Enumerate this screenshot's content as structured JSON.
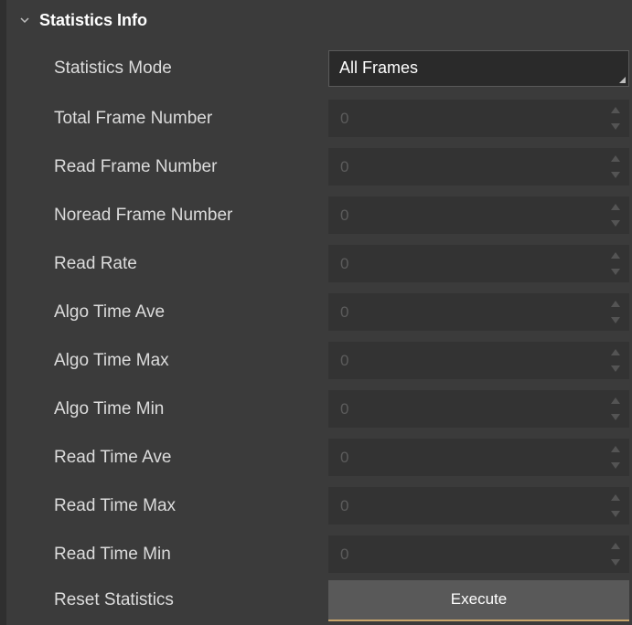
{
  "section": {
    "title": "Statistics Info",
    "toggle_icon": "chevron-down-icon"
  },
  "colors": {
    "panel_bg": "#3b3b3b",
    "field_bg": "#333333",
    "select_bg": "#2a2a2a",
    "button_bg": "#595959",
    "button_accent": "#c9a56b",
    "text": "#dcdcdc",
    "disabled_text": "#5c5c5c"
  },
  "statistics_mode": {
    "label": "Statistics Mode",
    "value": "All Frames"
  },
  "fields": [
    {
      "label": "Total Frame Number",
      "value": "0"
    },
    {
      "label": "Read Frame Number",
      "value": "0"
    },
    {
      "label": "Noread Frame Number",
      "value": "0"
    },
    {
      "label": "Read Rate",
      "value": "0"
    },
    {
      "label": "Algo Time Ave",
      "value": "0"
    },
    {
      "label": "Algo Time Max",
      "value": "0"
    },
    {
      "label": "Algo Time Min",
      "value": "0"
    },
    {
      "label": "Read Time Ave",
      "value": "0"
    },
    {
      "label": "Read Time Max",
      "value": "0"
    },
    {
      "label": "Read Time Min",
      "value": "0"
    }
  ],
  "reset": {
    "label": "Reset Statistics",
    "button_label": "Execute"
  }
}
